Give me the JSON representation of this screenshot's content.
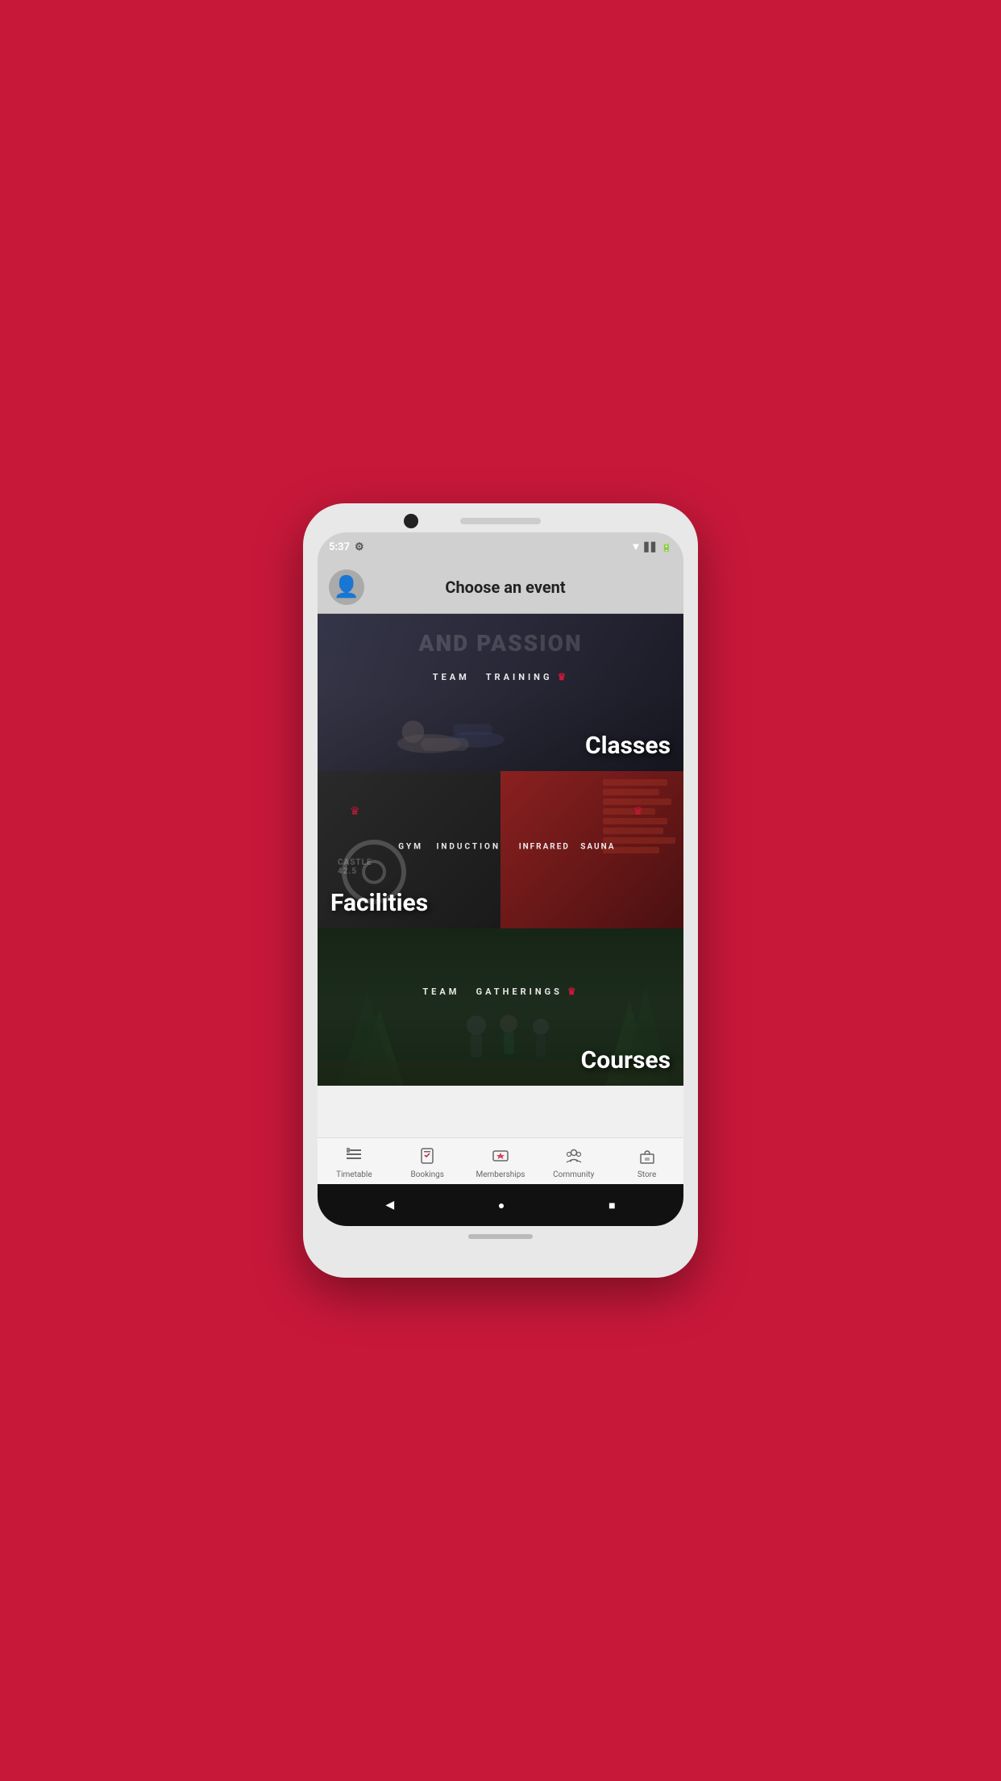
{
  "background_color": "#C8183A",
  "phone": {
    "status_bar": {
      "time": "5:37",
      "icons": [
        "settings",
        "wifi",
        "signal",
        "battery"
      ]
    },
    "header": {
      "title": "Choose an event",
      "avatar_label": "User avatar"
    },
    "event_cards": [
      {
        "id": "classes",
        "inner_label": "TEAM  TRAINING",
        "main_label": "Classes",
        "label_position": "right"
      },
      {
        "id": "facilities",
        "inner_label_left": "GYM  INDUCTION",
        "inner_label_right": "INFRARED  SAUNA",
        "main_label": "Facilities",
        "label_position": "left"
      },
      {
        "id": "courses",
        "inner_label": "TEAM  GATHERINGS",
        "main_label": "Courses",
        "label_position": "right"
      }
    ],
    "bottom_nav": {
      "items": [
        {
          "id": "timetable",
          "label": "Timetable",
          "icon": "≡"
        },
        {
          "id": "bookings",
          "label": "Bookings",
          "icon": "📋"
        },
        {
          "id": "memberships",
          "label": "Memberships",
          "icon": "⭐"
        },
        {
          "id": "community",
          "label": "Community",
          "icon": "👥"
        },
        {
          "id": "store",
          "label": "Store",
          "icon": "🛒"
        }
      ]
    },
    "android_nav": {
      "back_label": "◀",
      "home_label": "●",
      "recent_label": "■"
    }
  }
}
